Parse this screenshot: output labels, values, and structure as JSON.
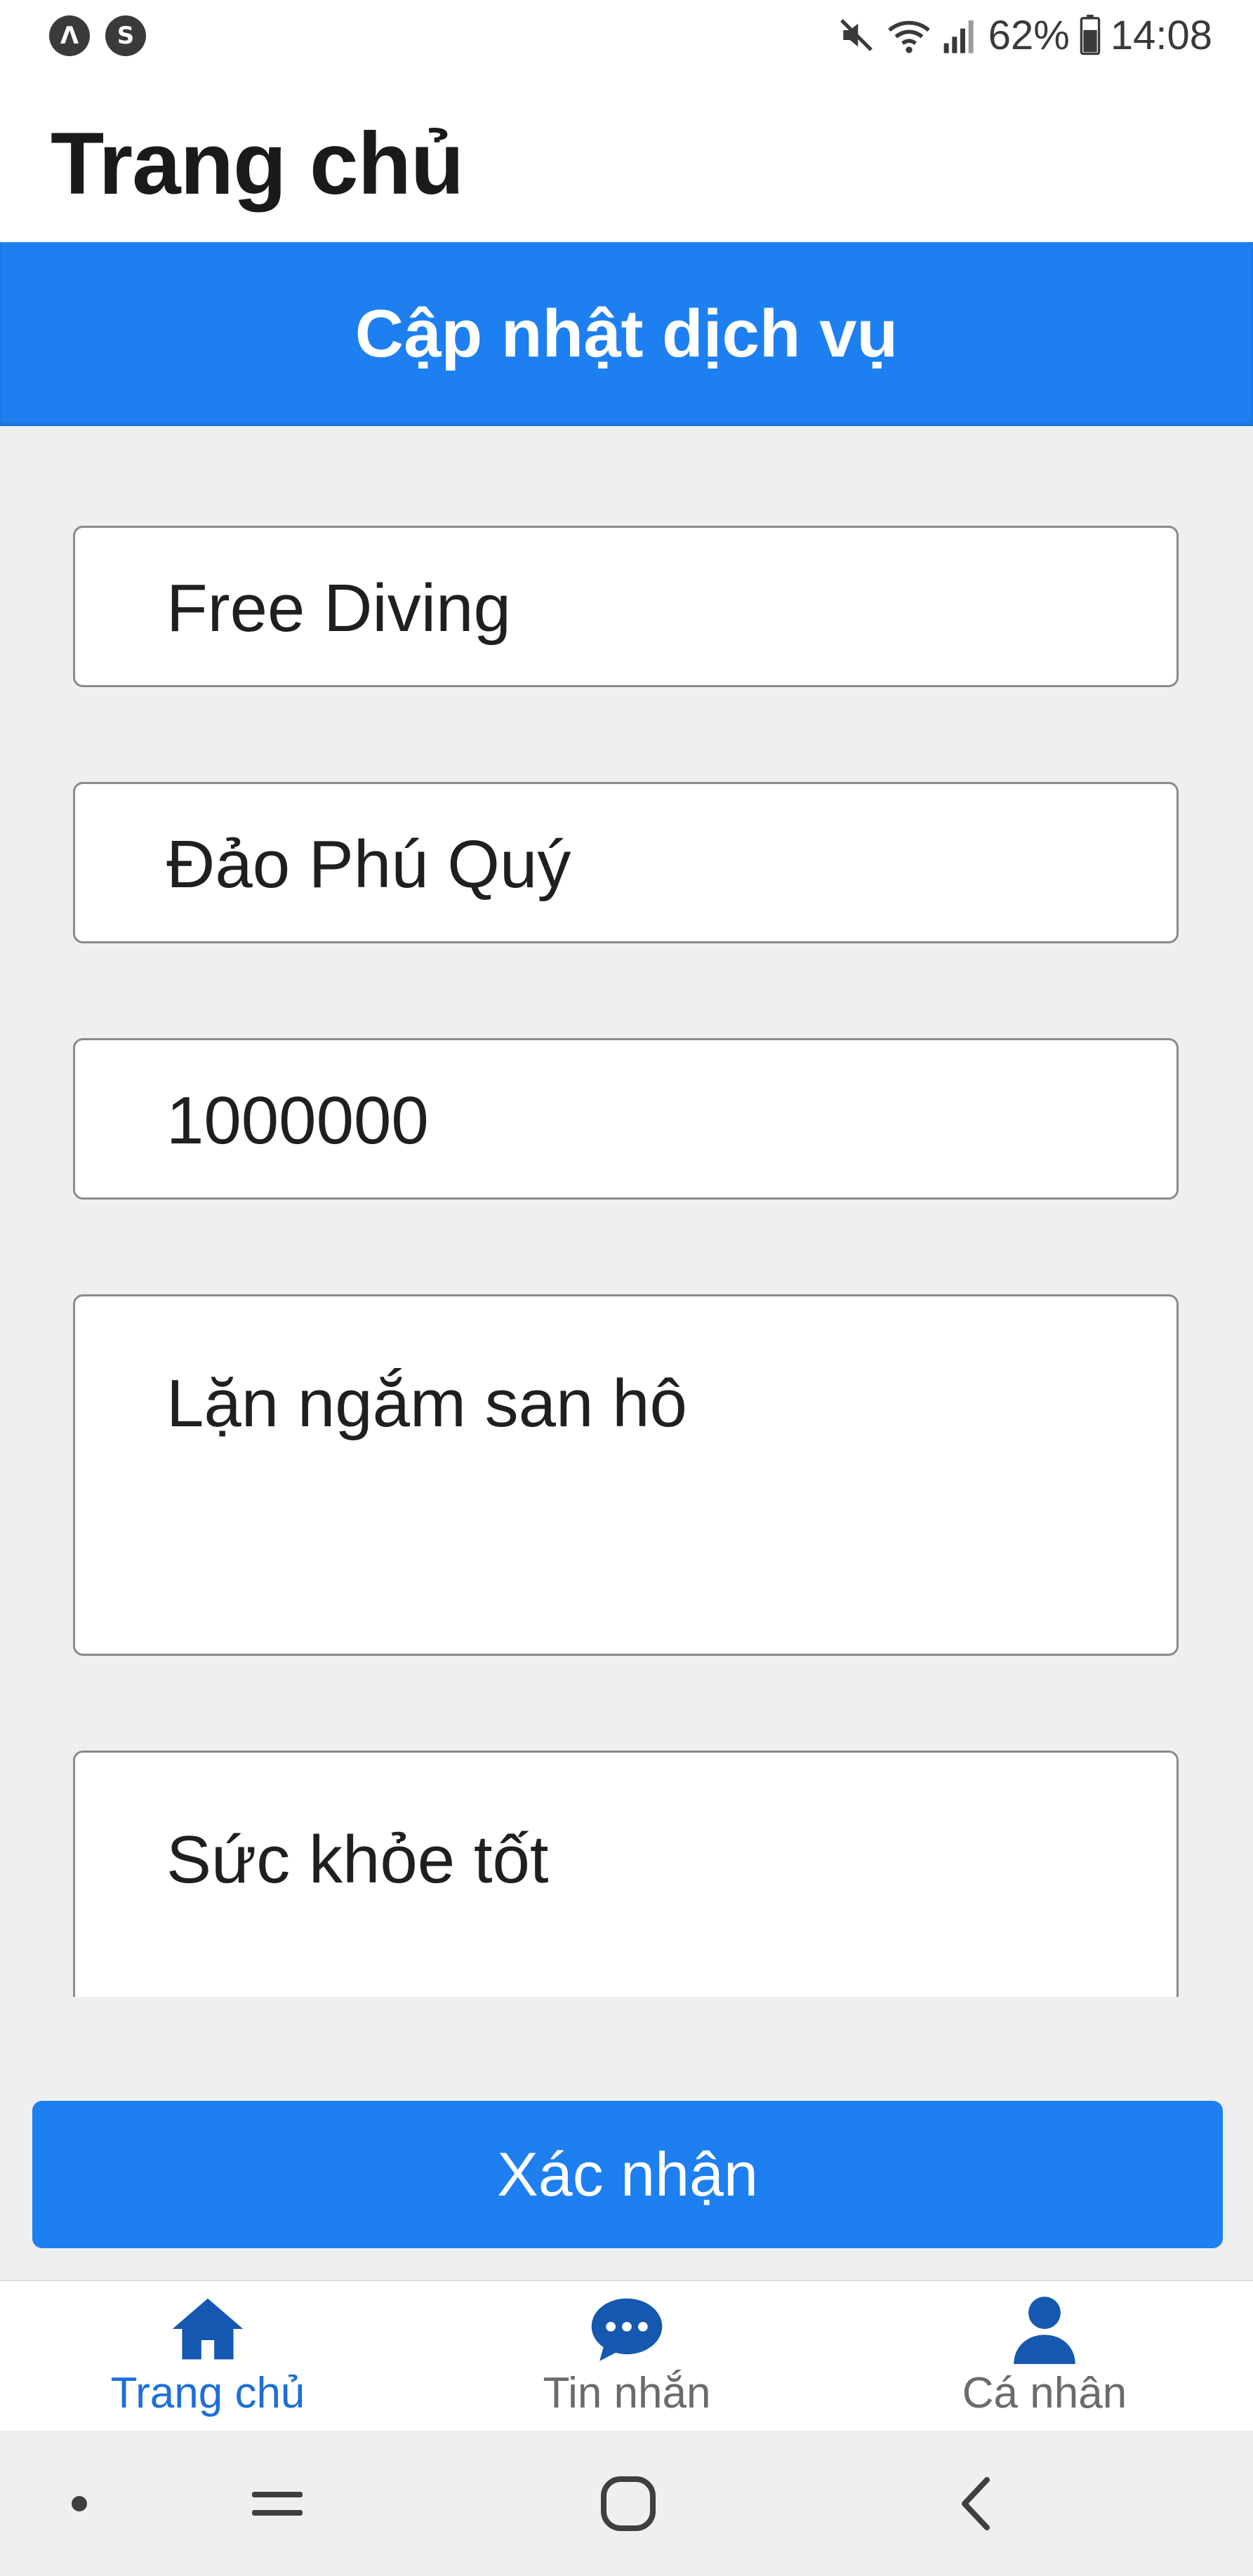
{
  "status_bar": {
    "left_icons": [
      "app-a-icon",
      "app-s-icon"
    ],
    "right_icons": [
      "mute-icon",
      "wifi-icon",
      "signal-icon",
      "battery-icon"
    ],
    "battery": "62%",
    "time": "14:08"
  },
  "header": {
    "title": "Trang chủ"
  },
  "banner": {
    "title": "Cập nhật dịch vụ"
  },
  "form": {
    "name": "Free Diving",
    "location": "Đảo Phú Quý",
    "price": "1000000",
    "description": "Lặn ngắm san hô",
    "requirement": "Sức khỏe tốt"
  },
  "confirm_button": {
    "label": "Xác nhận"
  },
  "bottom_nav": {
    "items": [
      {
        "label": "Trang chủ",
        "icon": "home-icon",
        "active": true
      },
      {
        "label": "Tin nhắn",
        "icon": "chat-icon",
        "active": false
      },
      {
        "label": "Cá nhân",
        "icon": "person-icon",
        "active": false
      }
    ]
  },
  "colors": {
    "accent": "#1d7ff0",
    "active_tab": "#1d6fd8",
    "nav_icon": "#1558b0",
    "background": "#efefef"
  }
}
